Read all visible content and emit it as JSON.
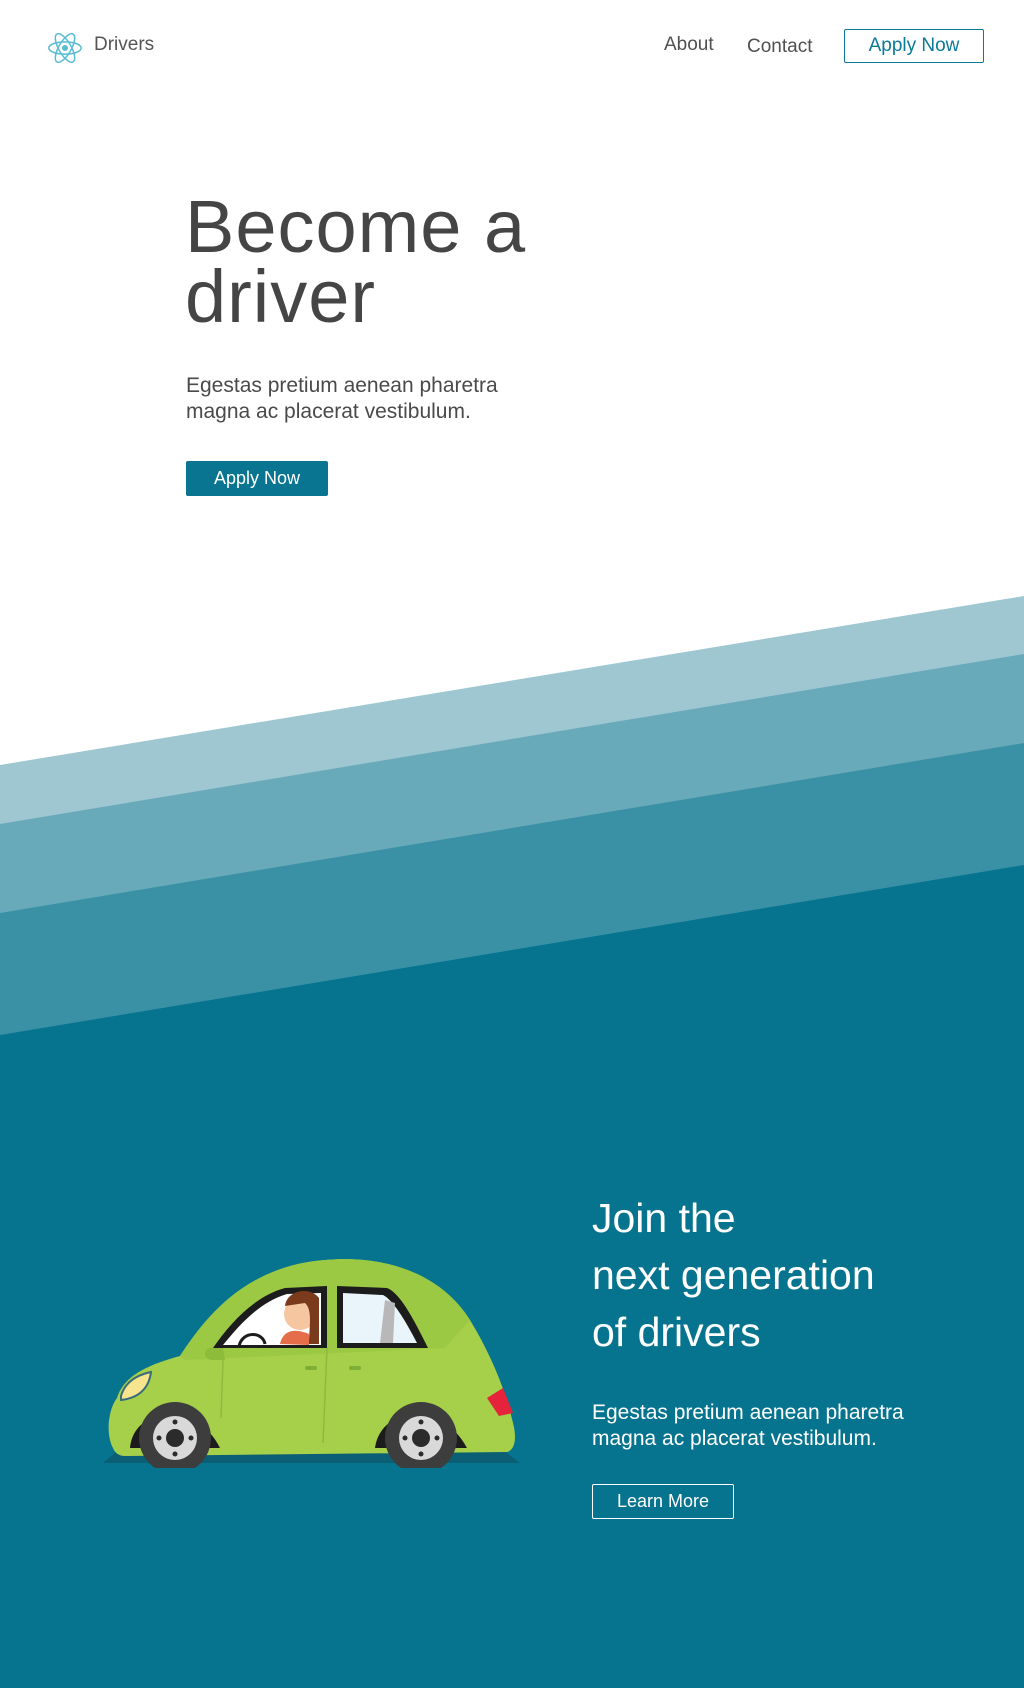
{
  "header": {
    "brand_name": "Drivers",
    "logo_icon": "atom-icon",
    "nav": {
      "about": "About",
      "contact": "Contact",
      "apply": "Apply Now"
    }
  },
  "hero": {
    "title_line1": "Become a",
    "title_line2": "driver",
    "subtitle": "Egestas pretium aenean pharetra magna ac placerat vestibulum.",
    "apply_label": "Apply Now"
  },
  "join": {
    "title_line1": "Join the",
    "title_line2": "next generation",
    "title_line3": "of drivers",
    "subtitle": "Egestas pretium aenean pharetra magna ac placerat vestibulum.",
    "learn_more_label": "Learn More",
    "illustration": "car-illustration"
  },
  "colors": {
    "primary": "#07748f",
    "wave_light": "#9fc7d2",
    "wave_mid": "#69aaba",
    "wave_dark": "#3a91a6",
    "logo": "#5bbcd4",
    "car_body": "#a6cf4a"
  }
}
